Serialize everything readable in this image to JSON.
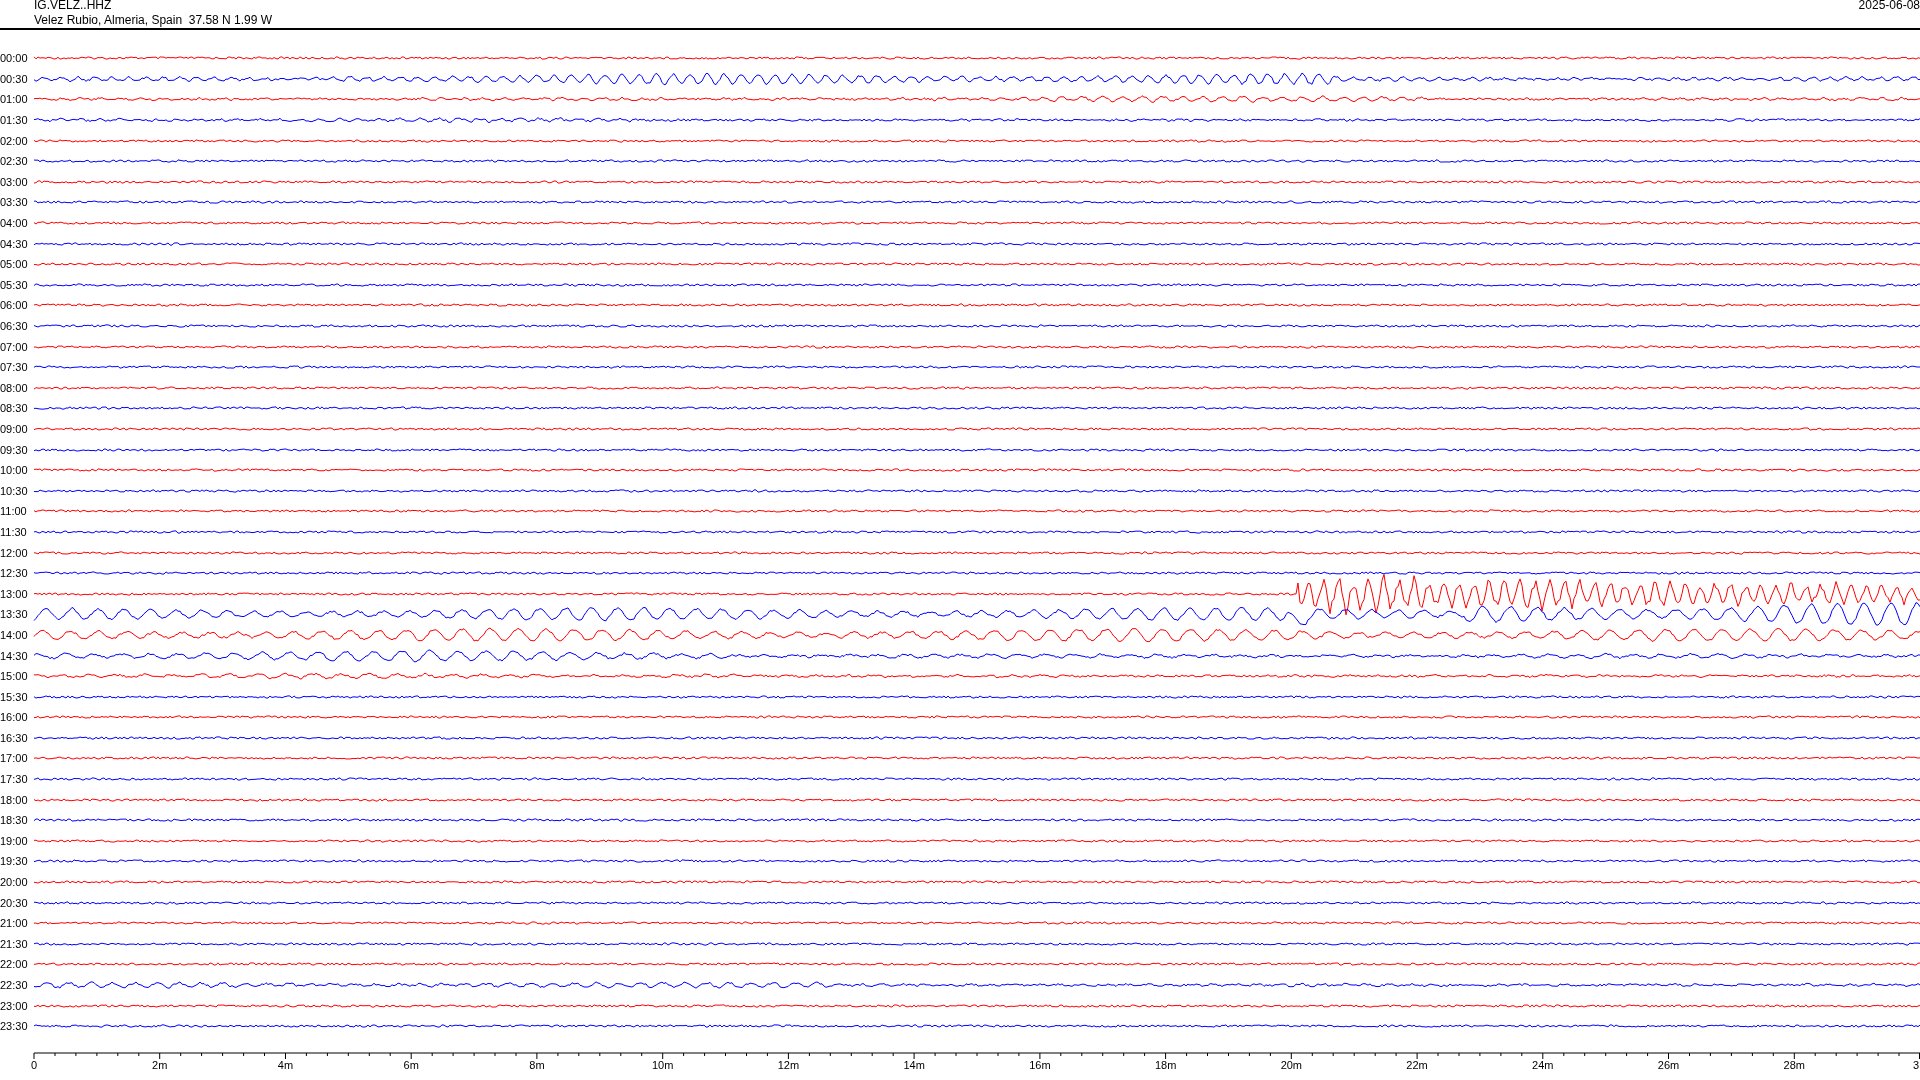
{
  "header": {
    "station": "IG.VELZ..HHZ",
    "location": "Velez Rubio, Almeria, Spain  37.58 N 1.99 W",
    "date": "2025-06-08"
  },
  "traces": [
    {
      "time": "00:00",
      "color": "#ff0000"
    },
    {
      "time": "00:30",
      "color": "#0000ff"
    },
    {
      "time": "01:00",
      "color": "#ff0000"
    },
    {
      "time": "01:30",
      "color": "#0000ff"
    },
    {
      "time": "02:00",
      "color": "#ff0000"
    },
    {
      "time": "02:30",
      "color": "#0000ff"
    },
    {
      "time": "03:00",
      "color": "#ff0000"
    },
    {
      "time": "03:30",
      "color": "#0000ff"
    },
    {
      "time": "04:00",
      "color": "#ff0000"
    },
    {
      "time": "04:30",
      "color": "#0000ff"
    },
    {
      "time": "05:00",
      "color": "#ff0000"
    },
    {
      "time": "05:30",
      "color": "#0000ff"
    },
    {
      "time": "06:00",
      "color": "#ff0000"
    },
    {
      "time": "06:30",
      "color": "#0000ff"
    },
    {
      "time": "07:00",
      "color": "#ff0000"
    },
    {
      "time": "07:30",
      "color": "#0000ff"
    },
    {
      "time": "08:00",
      "color": "#ff0000"
    },
    {
      "time": "08:30",
      "color": "#0000ff"
    },
    {
      "time": "09:00",
      "color": "#ff0000"
    },
    {
      "time": "09:30",
      "color": "#0000ff"
    },
    {
      "time": "10:00",
      "color": "#ff0000"
    },
    {
      "time": "10:30",
      "color": "#0000ff"
    },
    {
      "time": "11:00",
      "color": "#ff0000"
    },
    {
      "time": "11:30",
      "color": "#0000ff"
    },
    {
      "time": "12:00",
      "color": "#ff0000"
    },
    {
      "time": "12:30",
      "color": "#0000ff"
    },
    {
      "time": "13:00",
      "color": "#ff0000"
    },
    {
      "time": "13:30",
      "color": "#0000ff"
    },
    {
      "time": "14:00",
      "color": "#ff0000"
    },
    {
      "time": "14:30",
      "color": "#0000ff"
    },
    {
      "time": "15:00",
      "color": "#ff0000"
    },
    {
      "time": "15:30",
      "color": "#0000ff"
    },
    {
      "time": "16:00",
      "color": "#ff0000"
    },
    {
      "time": "16:30",
      "color": "#0000ff"
    },
    {
      "time": "17:00",
      "color": "#ff0000"
    },
    {
      "time": "17:30",
      "color": "#0000ff"
    },
    {
      "time": "18:00",
      "color": "#ff0000"
    },
    {
      "time": "18:30",
      "color": "#0000ff"
    },
    {
      "time": "19:00",
      "color": "#ff0000"
    },
    {
      "time": "19:30",
      "color": "#0000ff"
    },
    {
      "time": "20:00",
      "color": "#ff0000"
    },
    {
      "time": "20:30",
      "color": "#0000ff"
    },
    {
      "time": "21:00",
      "color": "#ff0000"
    },
    {
      "time": "21:30",
      "color": "#0000ff"
    },
    {
      "time": "22:00",
      "color": "#ff0000"
    },
    {
      "time": "22:30",
      "color": "#0000ff"
    },
    {
      "time": "23:00",
      "color": "#ff0000"
    },
    {
      "time": "23:30",
      "color": "#0000ff"
    }
  ],
  "x_axis": {
    "ticks": [
      "0",
      "2m",
      "4m",
      "6m",
      "8m",
      "10m",
      "12m",
      "14m",
      "16m",
      "18m",
      "20m",
      "22m",
      "24m",
      "26m",
      "28m",
      "3"
    ]
  }
}
